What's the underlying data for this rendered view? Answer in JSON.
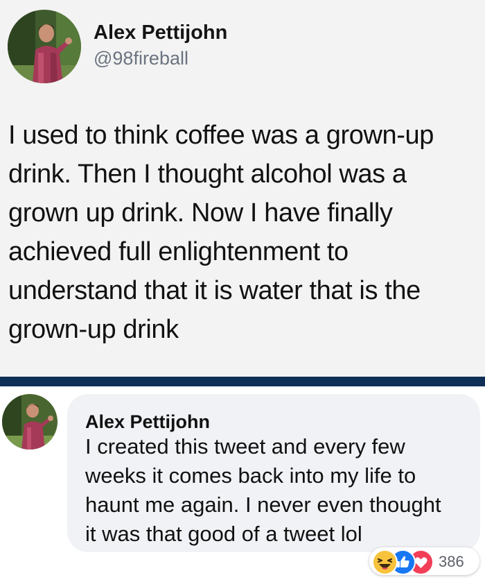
{
  "tweet": {
    "author_name": "Alex Pettijohn",
    "handle": "@98fireball",
    "text_lines": [
      "I used to think coffee was a grown-up",
      "drink. Then I thought alcohol was a",
      "grown up drink. Now I have finally",
      "achieved full enlightenment to",
      "understand that it is water that is the",
      "grown-up drink"
    ]
  },
  "comment": {
    "author_name": "Alex Pettijohn",
    "text_lines": [
      "I created this tweet and every few",
      "weeks it comes back into my life to",
      "haunt me again. I never even thought",
      "it was that good of a tweet lol"
    ],
    "reactions": {
      "icons": [
        "haha-icon",
        "like-icon",
        "love-icon"
      ],
      "count": "386"
    }
  },
  "colors": {
    "tweet_background": "#f3f3f3",
    "handle": "#6b7480",
    "divider": "#0f2f57",
    "comment_bubble": "#f0f2f5",
    "like_blue": "#1877f2",
    "love_red": "#f33e58",
    "haha_yellow": "#f7c33c"
  }
}
